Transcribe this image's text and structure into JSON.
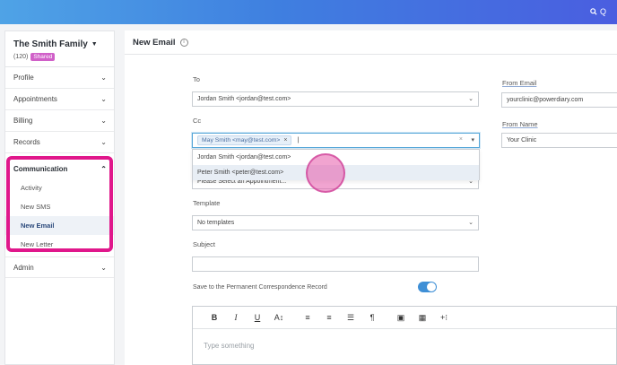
{
  "topbar": {
    "search_icon": "search-icon",
    "search_text": "Q"
  },
  "sidebar": {
    "family_name": "The Smith Family",
    "family_count": "(120)",
    "family_badge": "Shared",
    "items": [
      {
        "label": "Profile"
      },
      {
        "label": "Appointments"
      },
      {
        "label": "Billing"
      },
      {
        "label": "Records"
      }
    ],
    "communication": {
      "label": "Communication",
      "subitems": [
        {
          "label": "Activity"
        },
        {
          "label": "New SMS"
        },
        {
          "label": "New Email"
        },
        {
          "label": "New Letter"
        }
      ]
    },
    "admin": {
      "label": "Admin"
    }
  },
  "main": {
    "title": "New Email",
    "to_label": "To",
    "to_value": "Jordan Smith <jordan@test.com>",
    "cc_label": "Cc",
    "cc_tag": "May Smith <may@test.com>",
    "cc_dropdown": [
      "Jordan Smith <jordan@test.com>",
      "Peter Smith <peter@test.com>"
    ],
    "appointment_placeholder": "Please Select an Appointment...",
    "template_label": "Template",
    "template_value": "No templates",
    "subject_label": "Subject",
    "subject_value": "",
    "save_label": "Save to the Permanent Correspondence Record",
    "save_enabled": true,
    "from_email_label": "From Email",
    "from_email_value": "yourclinic@powerdiary.com",
    "from_name_label": "From Name",
    "from_name_value": "Your Clinic",
    "editor_placeholder": "Type something",
    "toolbar": [
      "B",
      "I",
      "U",
      "A↕",
      "≡",
      "≡",
      "☰",
      "¶",
      "▣",
      "▦",
      "+⁝"
    ]
  },
  "colors": {
    "accent": "#3e8fd6",
    "highlight": "#e0178b",
    "badge": "#d060c8"
  }
}
